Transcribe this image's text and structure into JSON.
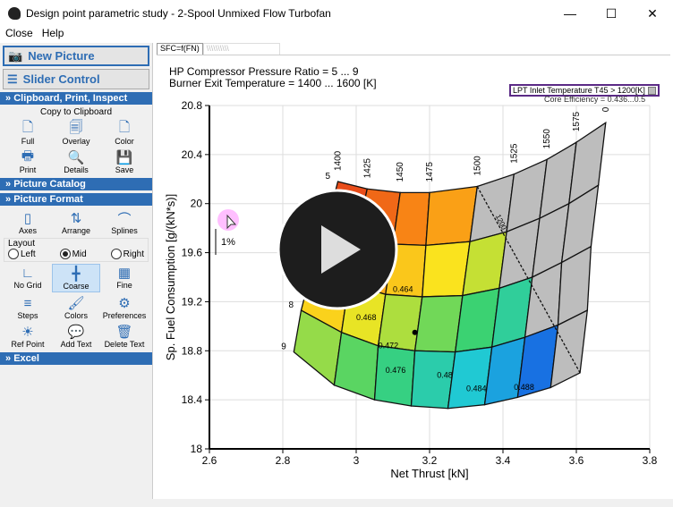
{
  "window": {
    "title": "Design point parametric study - 2-Spool Unmixed Flow Turbofan",
    "minimize": "—",
    "maximize": "☐",
    "close": "✕"
  },
  "menu": [
    "Close",
    "Help"
  ],
  "left": {
    "new_picture": "New Picture",
    "slider_control": "Slider Control",
    "clipboard_section": "Clipboard, Print, Inspect",
    "copy_to_clipboard": "Copy to Clipboard",
    "clipboard_tools": [
      {
        "label": "Full",
        "icon": "page-icon"
      },
      {
        "label": "Overlay",
        "icon": "pages-icon"
      },
      {
        "label": "Color",
        "icon": "color-page-icon"
      },
      {
        "label": "Print",
        "icon": "printer-icon"
      },
      {
        "label": "Details",
        "icon": "details-icon"
      },
      {
        "label": "Save",
        "icon": "floppy-icon"
      }
    ],
    "catalog_section": "Picture Catalog",
    "format_section": "Picture Format",
    "format_tools": [
      {
        "label": "Axes",
        "icon": "axes-icon"
      },
      {
        "label": "Arrange",
        "icon": "arrange-icon"
      },
      {
        "label": "Splines",
        "icon": "splines-icon"
      }
    ],
    "layout_label": "Layout",
    "layout_options": [
      "Left",
      "Mid",
      "Right"
    ],
    "layout_selected": "Mid",
    "grid_tools": [
      {
        "label": "No Grid",
        "icon": "no-grid-icon"
      },
      {
        "label": "Coarse",
        "icon": "coarse-grid-icon",
        "selected": true
      },
      {
        "label": "Fine",
        "icon": "fine-grid-icon"
      },
      {
        "label": "Steps",
        "icon": "steps-icon"
      },
      {
        "label": "Colors",
        "icon": "brush-icon"
      },
      {
        "label": "Preferences",
        "icon": "gear-icon"
      },
      {
        "label": "Ref Point",
        "icon": "sun-icon"
      },
      {
        "label": "Add Text",
        "icon": "comment-icon"
      },
      {
        "label": "Delete Text",
        "icon": "trash-icon"
      }
    ],
    "excel_section": "Excel"
  },
  "tabs": {
    "active": "SFC=f(FN)"
  },
  "info": {
    "line1": "HP Compressor Pressure Ratio = 5 ... 9",
    "line2": "Burner Exit Temperature = 1400 ... 1600 [K]"
  },
  "legend": {
    "label": "LPT Inlet Temperature T45 > 1200[K]",
    "core_efficiency": "Core Efficiency = 0.436...0.5"
  },
  "chart_data": {
    "type": "carpet",
    "xlabel": "Net Thrust [kN]",
    "ylabel": "Sp. Fuel Consumption [g/(kN*s)]",
    "xlim": [
      2.6,
      3.8
    ],
    "ylim": [
      18,
      20.8
    ],
    "xticks": [
      "2.6",
      "2.8",
      "3",
      "3.2",
      "3.4",
      "3.6",
      "3.8"
    ],
    "yticks": [
      "18",
      "18.4",
      "18.8",
      "19.2",
      "19.6",
      "20",
      "20.4",
      "20.8"
    ],
    "grid": "coarse",
    "pressure_ratios": [
      5,
      6,
      7,
      8,
      9
    ],
    "pressure_ratio_labels": [
      "5",
      "8",
      "9"
    ],
    "temperatures": [
      1400,
      1425,
      1450,
      1475,
      1500,
      1525,
      1550,
      1575,
      1600
    ],
    "temperature_labels": [
      "1400",
      "1425",
      "1450",
      "1475",
      "1500",
      "1525",
      "1550",
      "1575",
      "0"
    ],
    "nodes": [
      [
        [
          2.95,
          20.18
        ],
        [
          3.03,
          20.12
        ],
        [
          3.12,
          20.09
        ],
        [
          3.2,
          20.09
        ],
        [
          3.33,
          20.14
        ],
        [
          3.43,
          20.24
        ],
        [
          3.52,
          20.36
        ],
        [
          3.6,
          20.5
        ],
        [
          3.68,
          20.66
        ]
      ],
      [
        [
          2.92,
          19.83
        ],
        [
          3.0,
          19.72
        ],
        [
          3.1,
          19.67
        ],
        [
          3.19,
          19.66
        ],
        [
          3.31,
          19.69
        ],
        [
          3.41,
          19.77
        ],
        [
          3.5,
          19.88
        ],
        [
          3.58,
          20.0
        ],
        [
          3.66,
          20.15
        ]
      ],
      [
        [
          2.88,
          19.48
        ],
        [
          2.98,
          19.35
        ],
        [
          3.08,
          19.26
        ],
        [
          3.18,
          19.24
        ],
        [
          3.29,
          19.25
        ],
        [
          3.39,
          19.31
        ],
        [
          3.48,
          19.4
        ],
        [
          3.56,
          19.52
        ],
        [
          3.64,
          19.65
        ]
      ],
      [
        [
          2.85,
          19.13
        ],
        [
          2.96,
          18.95
        ],
        [
          3.06,
          18.84
        ],
        [
          3.16,
          18.8
        ],
        [
          3.27,
          18.79
        ],
        [
          3.37,
          18.83
        ],
        [
          3.46,
          18.91
        ],
        [
          3.55,
          19.01
        ],
        [
          3.63,
          19.13
        ]
      ],
      [
        [
          2.83,
          18.79
        ],
        [
          2.94,
          18.52
        ],
        [
          3.05,
          18.4
        ],
        [
          3.15,
          18.35
        ],
        [
          3.25,
          18.33
        ],
        [
          3.35,
          18.36
        ],
        [
          3.44,
          18.42
        ],
        [
          3.53,
          18.5
        ],
        [
          3.61,
          18.62
        ]
      ]
    ],
    "core_efficiency_range": [
      0.436,
      0.5
    ],
    "contour_labels": [
      "0.464",
      "0.468",
      "0.472",
      "0.476",
      "0.48",
      "0.484",
      "0.488"
    ],
    "limit_label": "1200",
    "scale_label": "1%",
    "ref_point": [
      3.16,
      18.95
    ]
  },
  "colors": {
    "accent": "#2e6db4",
    "limit_region": "#bdbdbd",
    "legend_border": "#5b2a86"
  }
}
